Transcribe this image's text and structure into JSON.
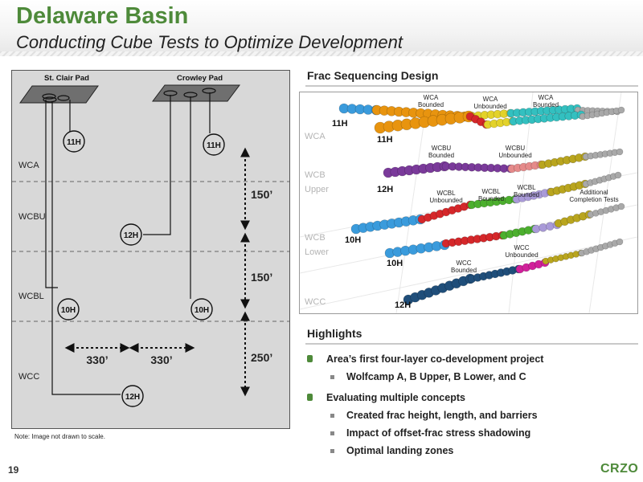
{
  "title": "Delaware Basin",
  "subtitle": "Conducting Cube Tests to Optimize Development",
  "diagram": {
    "pads": [
      "St. Clair Pad",
      "Crowley Pad"
    ],
    "zones": [
      "WCA",
      "WCBU",
      "WCBL",
      "WCC"
    ],
    "wells": {
      "stclair_11h": "11H",
      "crowley_11h": "11H",
      "crowley_12h": "12H",
      "stclair_10h": "10H",
      "crowley_10h": "10H",
      "stclair_12h": "12H"
    },
    "spacing": {
      "horizontal_1": "330’",
      "horizontal_2": "330’",
      "vertical_1": "150’",
      "vertical_2": "150’",
      "vertical_3": "250’"
    },
    "note": "Note: Image not drawn to scale."
  },
  "frac": {
    "heading": "Frac Sequencing Design",
    "zones": {
      "wca": "WCA",
      "wcb_upper_1": "WCB",
      "wcb_upper_2": "Upper",
      "wcb_lower_1": "WCB",
      "wcb_lower_2": "Lower",
      "wcc": "WCC"
    },
    "wells": {
      "w11a": "11H",
      "w11b": "11H",
      "w12a": "12H",
      "w10a": "10H",
      "w10b": "10H",
      "w12b": "12H"
    },
    "labels": {
      "wca_bounded_1": [
        "WCA",
        "Bounded"
      ],
      "wca_unbounded": [
        "WCA",
        "Unbounded"
      ],
      "wca_bounded_2": [
        "WCA",
        "Bounded"
      ],
      "wcbu_bounded": [
        "WCBU",
        "Bounded"
      ],
      "wcbu_unbounded": [
        "WCBU",
        "Unbounded"
      ],
      "wcbl_unbounded": [
        "WCBL",
        "Unbounded"
      ],
      "wcbl_bounded_1": [
        "WCBL",
        "Bounded"
      ],
      "wcbl_bounded_2": [
        "WCBL",
        "Bounded"
      ],
      "additional": [
        "Additional",
        "Completion Tests"
      ],
      "wcc_unbounded": [
        "WCC",
        "Unbounded"
      ],
      "wcc_bounded": [
        "WCC",
        "Bounded"
      ]
    },
    "colors": {
      "blue": "#3a9bdc",
      "orange": "#e8940f",
      "yellow": "#e3d22a",
      "red": "#d5272a",
      "teal": "#33c0c0",
      "purple": "#7a3a9a",
      "pink": "#e58a8a",
      "green": "#4caf2e",
      "lavender": "#a99ad8",
      "olive": "#b9a51e",
      "gray": "#a9a9a9",
      "navy": "#1f4e7a",
      "magenta": "#d0209a"
    }
  },
  "highlights": {
    "heading": "Highlights",
    "items": [
      {
        "text": "Area’s first four-layer co-development project",
        "sub": [
          "Wolfcamp A, B Upper, B Lower, and C"
        ]
      },
      {
        "text": "Evaluating multiple concepts",
        "sub": [
          "Created frac height, length, and barriers",
          "Impact of offset-frac stress shadowing",
          "Optimal landing zones"
        ]
      }
    ]
  },
  "footer": {
    "page": "19",
    "logo": "CRZO"
  }
}
